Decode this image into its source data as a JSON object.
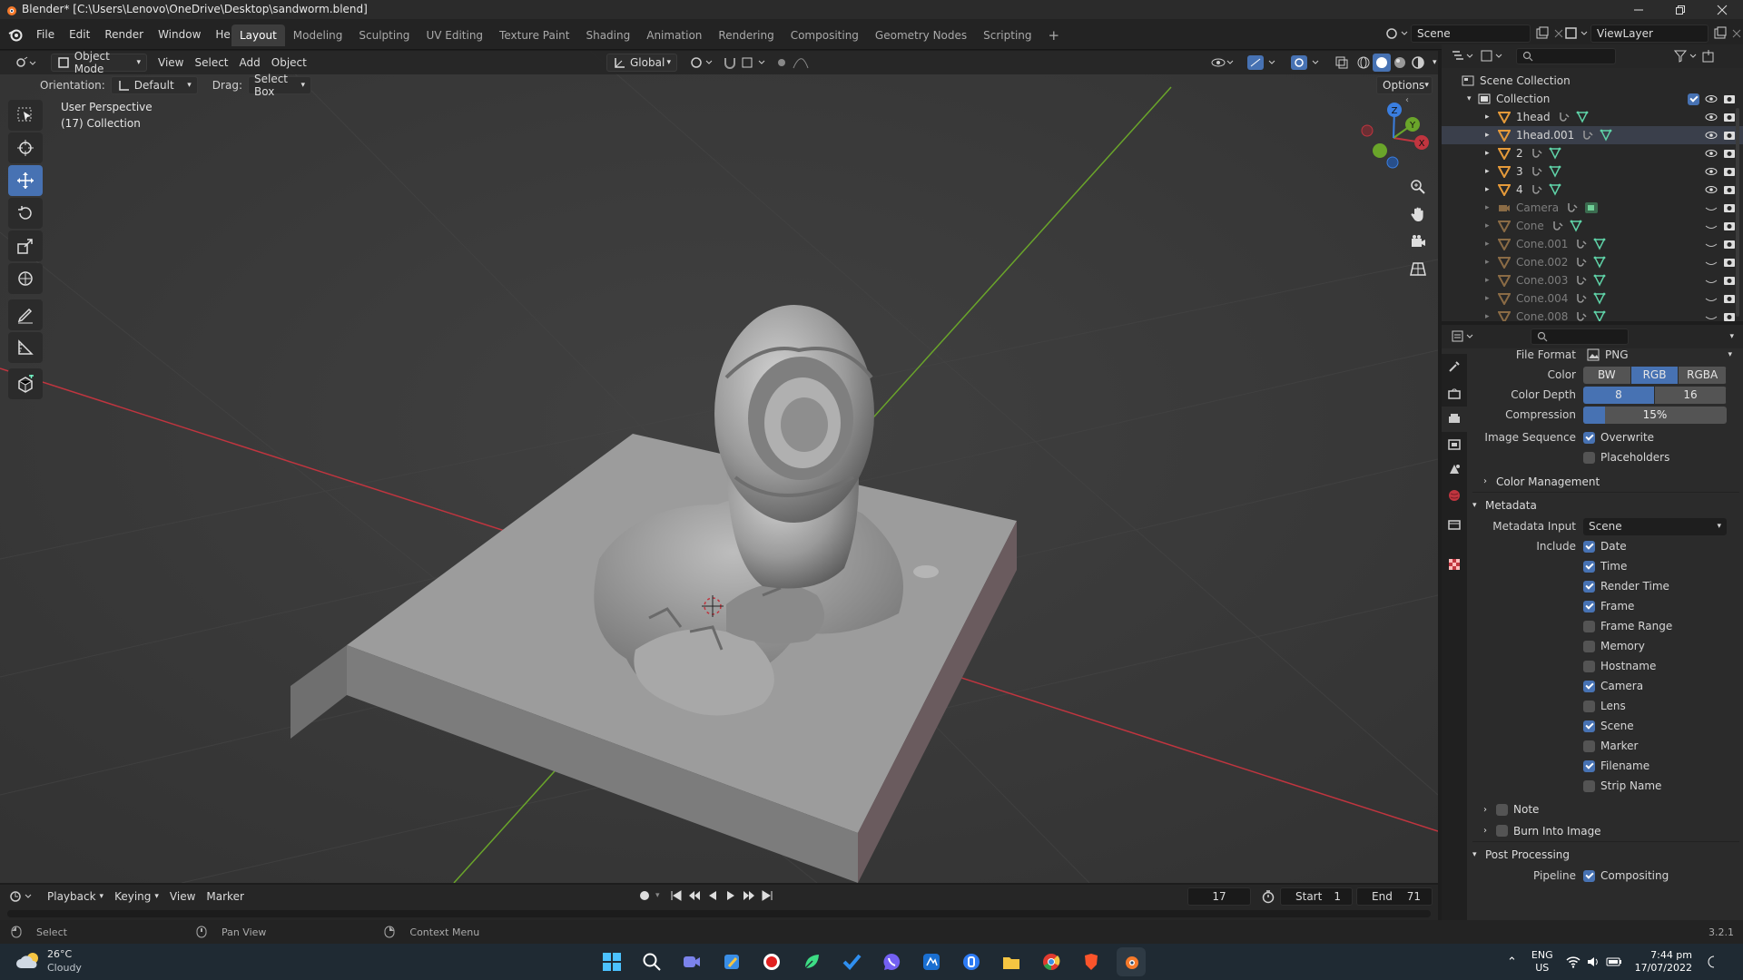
{
  "window": {
    "title": "Blender* [C:\\Users\\Lenovo\\OneDrive\\Desktop\\sandworm.blend]"
  },
  "menus": [
    "File",
    "Edit",
    "Render",
    "Window",
    "Help"
  ],
  "workspaces": [
    "Layout",
    "Modeling",
    "Sculpting",
    "UV Editing",
    "Texture Paint",
    "Shading",
    "Animation",
    "Rendering",
    "Compositing",
    "Geometry Nodes",
    "Scripting"
  ],
  "scene": {
    "name": "Scene",
    "view_layer": "ViewLayer"
  },
  "viewport": {
    "mode": "Object Mode",
    "menus": [
      "View",
      "Select",
      "Add",
      "Object"
    ],
    "transform_orientation": "Global",
    "orientation_label": "Orientation:",
    "orientation_value": "Default",
    "drag_label": "Drag:",
    "drag_value": "Select Box",
    "options_label": "Options",
    "overlay_text": "User Perspective",
    "overlay_collection": "(17) Collection",
    "gizmo": {
      "x": "X",
      "y": "Y",
      "z": "Z"
    }
  },
  "outliner": {
    "root": "Scene Collection",
    "collection": "Collection",
    "items": [
      {
        "name": "1head",
        "dim": false,
        "selected": false
      },
      {
        "name": "1head.001",
        "dim": false,
        "selected": true
      },
      {
        "name": "2",
        "dim": false,
        "selected": false
      },
      {
        "name": "3",
        "dim": false,
        "selected": false
      },
      {
        "name": "4",
        "dim": false,
        "selected": false
      },
      {
        "name": "Camera",
        "dim": true,
        "selected": false
      },
      {
        "name": "Cone",
        "dim": true,
        "selected": false
      },
      {
        "name": "Cone.001",
        "dim": true,
        "selected": false
      },
      {
        "name": "Cone.002",
        "dim": true,
        "selected": false
      },
      {
        "name": "Cone.003",
        "dim": true,
        "selected": false
      },
      {
        "name": "Cone.004",
        "dim": true,
        "selected": false
      },
      {
        "name": "Cone.008",
        "dim": true,
        "selected": false
      }
    ]
  },
  "properties": {
    "file_format_label": "File Format",
    "file_format": "PNG",
    "color_label": "Color",
    "color_options": [
      "BW",
      "RGB",
      "RGBA"
    ],
    "color_active": 1,
    "color_depth_label": "Color Depth",
    "color_depth_options": [
      "8",
      "16"
    ],
    "compression_label": "Compression",
    "compression_value": "15%",
    "compression_fraction": 0.15,
    "image_sequence_label": "Image Sequence",
    "overwrite_label": "Overwrite",
    "placeholders_label": "Placeholders",
    "color_management": "Color Management",
    "metadata": "Metadata",
    "metadata_input_label": "Metadata Input",
    "metadata_input": "Scene",
    "include_label": "Include",
    "include": [
      {
        "label": "Date",
        "on": true
      },
      {
        "label": "Time",
        "on": true
      },
      {
        "label": "Render Time",
        "on": true
      },
      {
        "label": "Frame",
        "on": true
      },
      {
        "label": "Frame Range",
        "on": false
      },
      {
        "label": "Memory",
        "on": false
      },
      {
        "label": "Hostname",
        "on": false
      },
      {
        "label": "Camera",
        "on": true
      },
      {
        "label": "Lens",
        "on": false
      },
      {
        "label": "Scene",
        "on": true
      },
      {
        "label": "Marker",
        "on": false
      },
      {
        "label": "Filename",
        "on": true
      },
      {
        "label": "Strip Name",
        "on": false
      }
    ],
    "note": "Note",
    "burn": "Burn Into Image",
    "post_processing": "Post Processing",
    "pipeline_label": "Pipeline",
    "compositing_label": "Compositing"
  },
  "timeline": {
    "menus": [
      "Playback",
      "Keying",
      "View",
      "Marker"
    ],
    "current_frame": "17",
    "start_label": "Start",
    "start": "1",
    "end_label": "End",
    "end": "71"
  },
  "statusbar": {
    "select": "Select",
    "pan": "Pan View",
    "context": "Context Menu",
    "version": "3.2.1"
  },
  "taskbar": {
    "temp": "26°C",
    "weather": "Cloudy",
    "lang1": "ENG",
    "lang2": "US",
    "time": "7:44 pm",
    "date": "17/07/2022"
  },
  "colors": {
    "accent": "#4772b3",
    "x_axis": "#c0353f",
    "y_axis": "#6aa52a",
    "z_axis": "#3a7ee0",
    "mesh_orange": "#e59a3a"
  }
}
